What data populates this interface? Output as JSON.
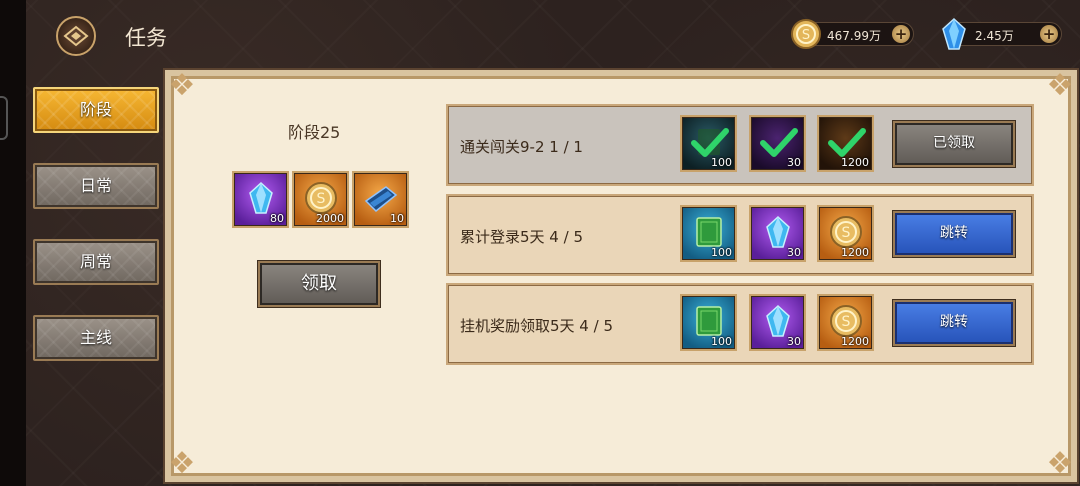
{
  "header": {
    "title": "任务",
    "gold": {
      "value": "467.99万",
      "icon": "gold-coin-icon"
    },
    "gem": {
      "value": "2.45万",
      "icon": "blue-crystal-icon"
    },
    "plus": "+"
  },
  "tabs": [
    {
      "label": "阶段",
      "active": true
    },
    {
      "label": "日常",
      "active": false
    },
    {
      "label": "周常",
      "active": false
    },
    {
      "label": "主线",
      "active": false
    }
  ],
  "stage": {
    "title": "阶段25",
    "rewards": [
      {
        "icon": "purple-crystal-icon",
        "qty": "80"
      },
      {
        "icon": "gold-coin-icon",
        "qty": "2000"
      },
      {
        "icon": "blue-book-icon",
        "qty": "10"
      }
    ],
    "claim_label": "领取"
  },
  "quests": [
    {
      "text": "通关闯关9-2 1 / 1",
      "status": "claimed",
      "rewards": [
        {
          "icon": "green-book-icon",
          "qty": "100",
          "claimed": true
        },
        {
          "icon": "purple-crystal-icon",
          "qty": "30",
          "claimed": true
        },
        {
          "icon": "gold-coin-icon",
          "qty": "1200",
          "claimed": true
        }
      ],
      "button_label": "已领取"
    },
    {
      "text": "累计登录5天 4 / 5",
      "status": "in-progress",
      "rewards": [
        {
          "icon": "green-book-icon",
          "qty": "100",
          "claimed": false
        },
        {
          "icon": "purple-crystal-icon",
          "qty": "30",
          "claimed": false
        },
        {
          "icon": "gold-coin-icon",
          "qty": "1200",
          "claimed": false
        }
      ],
      "button_label": "跳转"
    },
    {
      "text": "挂机奖励领取5天 4 / 5",
      "status": "in-progress",
      "rewards": [
        {
          "icon": "green-book-icon",
          "qty": "100",
          "claimed": false
        },
        {
          "icon": "purple-crystal-icon",
          "qty": "30",
          "claimed": false
        },
        {
          "icon": "gold-coin-icon",
          "qty": "1200",
          "claimed": false
        }
      ],
      "button_label": "跳转"
    }
  ],
  "colors": {
    "active_tab": "#f2a524",
    "jump_button": "#3a6fd8",
    "panel_bg": "#f6ecd8"
  }
}
